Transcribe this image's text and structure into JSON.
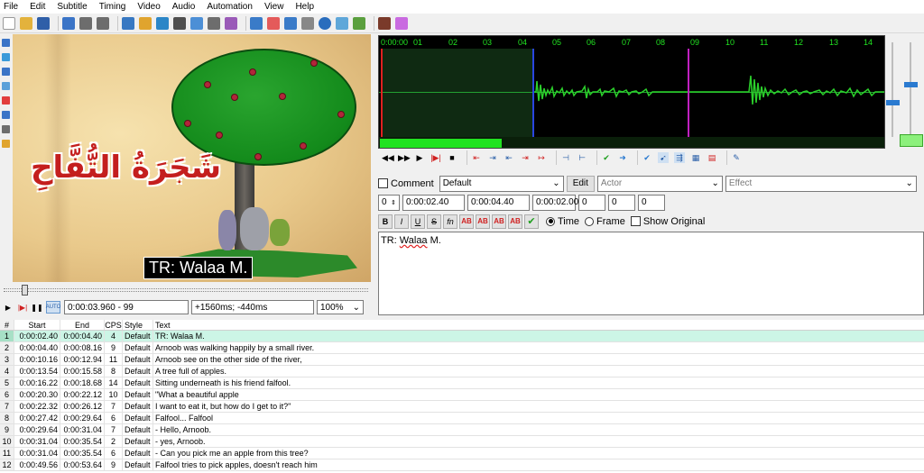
{
  "menu": [
    "File",
    "Edit",
    "Subtitle",
    "Timing",
    "Video",
    "Audio",
    "Automation",
    "View",
    "Help"
  ],
  "video": {
    "title_arabic": "شَجَرَةُ التُّفَّاحِ",
    "subtitle_overlay": "TR: Walaa M."
  },
  "video_controls": {
    "time_frame": "0:00:03.960 - 99",
    "offset": "+1560ms; -440ms",
    "zoom": "100%"
  },
  "audio": {
    "ruler_labels": [
      "0:00:00",
      "01",
      "02",
      "03",
      "04",
      "05",
      "06",
      "07",
      "08",
      "09",
      "10",
      "11",
      "12",
      "13",
      "14"
    ]
  },
  "edit": {
    "comment_label": "Comment",
    "style": "Default",
    "edit_button": "Edit",
    "actor_placeholder": "Actor",
    "effect_placeholder": "Effect",
    "layer": "0",
    "start_time": "0:00:02.40",
    "end_time": "0:00:04.40",
    "duration": "0:00:02.00",
    "margin_left": "0",
    "margin_right": "0",
    "margin_vert": "0",
    "bold": "B",
    "italic": "I",
    "underline": "U",
    "strike": "S",
    "font": "fn",
    "color_labels": [
      "AB",
      "AB",
      "AB",
      "AB"
    ],
    "time_label": "Time",
    "frame_label": "Frame",
    "show_original_label": "Show Original",
    "text_prefix": "TR: ",
    "text_word": "Walaa",
    "text_suffix": " M."
  },
  "grid": {
    "headers": {
      "num": "#",
      "start": "Start",
      "end": "End",
      "cps": "CPS",
      "style": "Style",
      "text": "Text"
    },
    "rows": [
      {
        "num": "1",
        "start": "0:00:02.40",
        "end": "0:00:04.40",
        "cps": "4",
        "style": "Default",
        "text": "TR: Walaa M."
      },
      {
        "num": "2",
        "start": "0:00:04.40",
        "end": "0:00:08.16",
        "cps": "9",
        "style": "Default",
        "text": "Arnoob was walking happily by a small river."
      },
      {
        "num": "3",
        "start": "0:00:10.16",
        "end": "0:00:12.94",
        "cps": "11",
        "style": "Default",
        "text": "Arnoob see on the other side of the river,"
      },
      {
        "num": "4",
        "start": "0:00:13.54",
        "end": "0:00:15.58",
        "cps": "8",
        "style": "Default",
        "text": "A tree full of apples."
      },
      {
        "num": "5",
        "start": "0:00:16.22",
        "end": "0:00:18.68",
        "cps": "14",
        "style": "Default",
        "text": "Sitting underneath is his friend falfool."
      },
      {
        "num": "6",
        "start": "0:00:20.30",
        "end": "0:00:22.12",
        "cps": "10",
        "style": "Default",
        "text": "\"What a beautiful apple"
      },
      {
        "num": "7",
        "start": "0:00:22.32",
        "end": "0:00:26.12",
        "cps": "7",
        "style": "Default",
        "text": "I want to eat it, but how do I get to it?\""
      },
      {
        "num": "8",
        "start": "0:00:27.42",
        "end": "0:00:29.64",
        "cps": "6",
        "style": "Default",
        "text": "Falfool... Falfool"
      },
      {
        "num": "9",
        "start": "0:00:29.64",
        "end": "0:00:31.04",
        "cps": "7",
        "style": "Default",
        "text": "- Hello, Arnoob."
      },
      {
        "num": "10",
        "start": "0:00:31.04",
        "end": "0:00:35.54",
        "cps": "2",
        "style": "Default",
        "text": "- yes, Arnoob."
      },
      {
        "num": "11",
        "start": "0:00:31.04",
        "end": "0:00:35.54",
        "cps": "6",
        "style": "Default",
        "text": "- Can you pick me an apple from this tree?"
      },
      {
        "num": "12",
        "start": "0:00:49.56",
        "end": "0:00:53.64",
        "cps": "9",
        "style": "Default",
        "text": "Falfool tries to pick apples, doesn't reach him"
      }
    ]
  }
}
